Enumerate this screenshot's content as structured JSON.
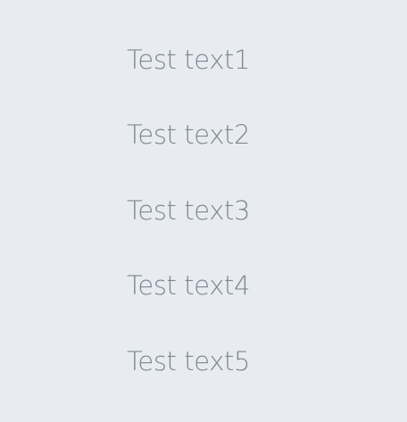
{
  "list": {
    "items": [
      {
        "label": "Test text1"
      },
      {
        "label": "Test text2"
      },
      {
        "label": "Test text3"
      },
      {
        "label": "Test text4"
      },
      {
        "label": "Test text5"
      }
    ]
  },
  "colors": {
    "background": "#e8ecf0",
    "text": "#7e8794"
  }
}
